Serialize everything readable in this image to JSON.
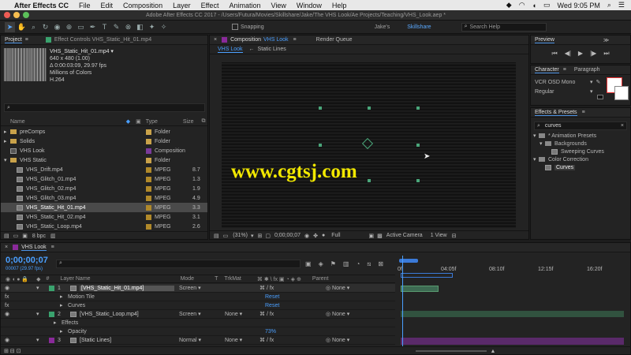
{
  "menubar": {
    "app_name": "After Effects CC",
    "items": [
      "File",
      "Edit",
      "Composition",
      "Layer",
      "Effect",
      "Animation",
      "View",
      "Window",
      "Help"
    ],
    "datetime": "Wed 9:05 PM"
  },
  "titlebar": {
    "title": "Adobe After Effects CC 2017 - /Users/Futura/Movies/Skillshare/Jake/The VHS Look/Ae Projects/Teaching/VHS_Look.aep *"
  },
  "toolbar": {
    "snapping_label": "Snapping",
    "workspaces": [
      "Jake's",
      "Skillshare"
    ],
    "search_placeholder": "Search Help"
  },
  "project": {
    "tab_label": "Project",
    "effect_controls_tab": "Effect Controls VHS_Static_Hit_01.mp4",
    "info": {
      "name": "VHS_Static_Hit_01.mp4 ▾",
      "size": "640 x 480 (1.00)",
      "duration": "Δ 0:00:03:09, 29.97 fps",
      "colors": "Millions of Colors",
      "codec": "H.264"
    },
    "col_name": "Name",
    "col_type": "Type",
    "col_size": "Size",
    "items": [
      {
        "name": "preComps",
        "type": "Folder",
        "size": "",
        "kind": "folder",
        "indent": 0,
        "label": "#c9a24a"
      },
      {
        "name": "Solids",
        "type": "Folder",
        "size": "",
        "kind": "folder",
        "indent": 0,
        "label": "#c9a24a"
      },
      {
        "name": "VHS Look",
        "type": "Composition",
        "size": "",
        "kind": "comp",
        "indent": 0,
        "label": "#7a3a9a"
      },
      {
        "name": "VHS Static",
        "type": "Folder",
        "size": "",
        "kind": "folder",
        "indent": 0,
        "label": "#c9a24a"
      },
      {
        "name": "VHS_Drift.mp4",
        "type": "MPEG",
        "size": "8.7",
        "kind": "film",
        "indent": 1,
        "label": "#b0892a"
      },
      {
        "name": "VHS_Glitch_01.mp4",
        "type": "MPEG",
        "size": "1.3",
        "kind": "film",
        "indent": 1,
        "label": "#b0892a"
      },
      {
        "name": "VHS_Glitch_02.mp4",
        "type": "MPEG",
        "size": "1.9",
        "kind": "film",
        "indent": 1,
        "label": "#b0892a"
      },
      {
        "name": "VHS_Glitch_03.mp4",
        "type": "MPEG",
        "size": "4.9",
        "kind": "film",
        "indent": 1,
        "label": "#b0892a"
      },
      {
        "name": "VHS_Static_Hit_01.mp4",
        "type": "MPEG",
        "size": "3.3",
        "kind": "film",
        "indent": 1,
        "label": "#b0892a"
      },
      {
        "name": "VHS_Static_Hit_02.mp4",
        "type": "MPEG",
        "size": "3.1",
        "kind": "film",
        "indent": 1,
        "label": "#b0892a"
      },
      {
        "name": "VHS_Static_Loop.mp4",
        "type": "MPEG",
        "size": "2.6",
        "kind": "film",
        "indent": 1,
        "label": "#b0892a"
      }
    ],
    "selected_index": 8,
    "bpc": "8 bpc"
  },
  "composition": {
    "tab_label": "Composition",
    "comp_name": "VHS Look",
    "render_queue_tab": "Render Queue",
    "sub_tabs": [
      "VHS Look",
      "Static Lines"
    ],
    "zoom": "(31%)",
    "timecode": "0;00;00;07",
    "resolution": "Full",
    "camera": "Active Camera",
    "views": "1 View",
    "watermark": "www.cgtsj.com"
  },
  "preview": {
    "tab_label": "Preview"
  },
  "character": {
    "tab_label": "Character",
    "paragraph_tab": "Paragraph",
    "font": "VCR OSD Mono",
    "style": "Regular"
  },
  "effects": {
    "tab_label": "Effects & Presets",
    "search_value": "curves",
    "tree": [
      {
        "label": "* Animation Presets",
        "indent": 0,
        "kind": "folder"
      },
      {
        "label": "Backgrounds",
        "indent": 1,
        "kind": "folder"
      },
      {
        "label": "Sweeping Curves",
        "indent": 2,
        "kind": "preset"
      },
      {
        "label": "Color Correction",
        "indent": 0,
        "kind": "folder"
      },
      {
        "label": "Curves",
        "indent": 1,
        "kind": "effect"
      }
    ]
  },
  "timeline": {
    "tab_label": "VHS Look",
    "timecode": "0;00;00;07",
    "frame_info": "00007 (29.97 fps)",
    "cols": {
      "source": "#",
      "layer_name": "Layer Name",
      "mode": "Mode",
      "t": "T",
      "trkmat": "TrkMat",
      "parent": "Parent"
    },
    "ruler": [
      "0f",
      "04:05f",
      "08:10f",
      "12:15f",
      "16:20f"
    ],
    "layers": [
      {
        "kind": "layer",
        "num": "1",
        "name": "[VHS_Static_Hit_01.mp4]",
        "mode": "Screen",
        "trkmat": "",
        "parent": "None",
        "color": "#3aa36e",
        "selected": true
      },
      {
        "kind": "prop",
        "name": "Motion Tile",
        "value": "Reset",
        "indent": 1
      },
      {
        "kind": "prop",
        "name": "Curves",
        "value": "Reset",
        "indent": 1
      },
      {
        "kind": "layer",
        "num": "2",
        "name": "[VHS_Static_Loop.mp4]",
        "mode": "Screen",
        "trkmat": "None",
        "parent": "None",
        "color": "#3aa36e",
        "selected": false
      },
      {
        "kind": "prop",
        "name": "Effects",
        "value": "",
        "indent": 0
      },
      {
        "kind": "prop",
        "name": "Opacity",
        "value": "73%",
        "indent": 1
      },
      {
        "kind": "layer",
        "num": "3",
        "name": "[Static Lines]",
        "mode": "Normal",
        "trkmat": "None",
        "parent": "None",
        "color": "#8a2a9a",
        "selected": false
      }
    ]
  },
  "colors": {
    "accent": "#4a9fff",
    "green_bar": "#3d6a52",
    "purple_bar": "#5a2a6a"
  }
}
